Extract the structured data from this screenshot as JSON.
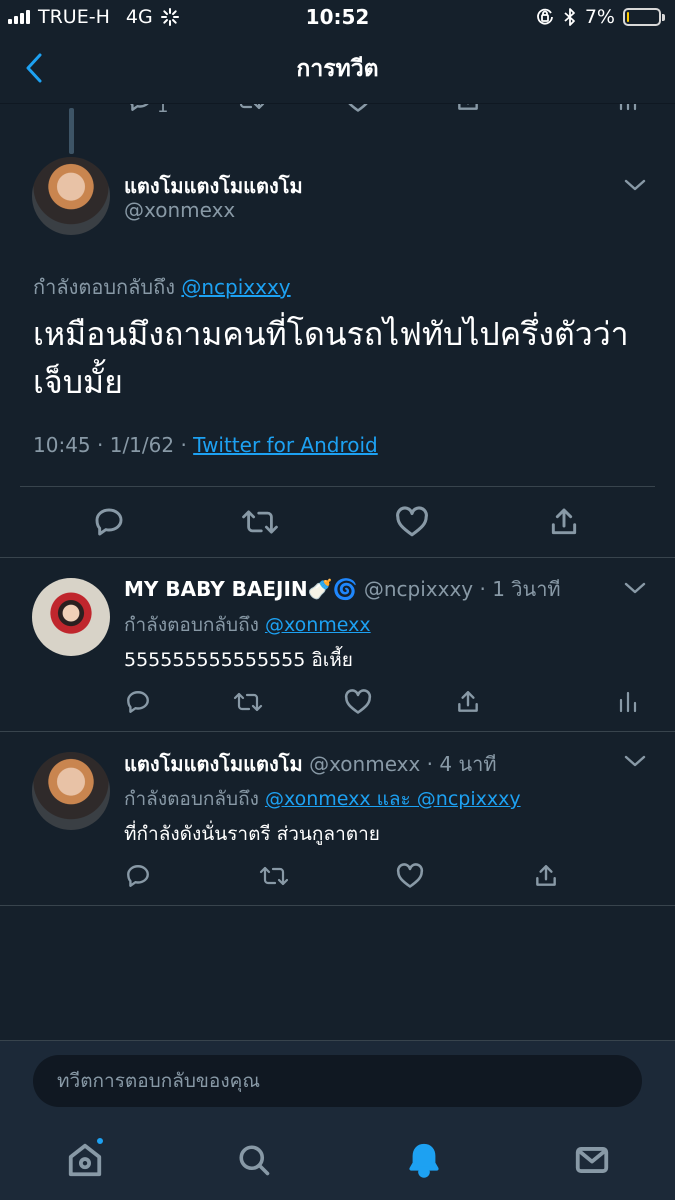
{
  "status_bar": {
    "carrier": "TRUE-H",
    "network": "4G",
    "time": "10:52",
    "battery_percent_label": "7%",
    "battery_level": 0.07
  },
  "nav": {
    "title": "การทวีต"
  },
  "top_actions": {
    "reply_count": "1"
  },
  "main_tweet": {
    "name": "แตงโมแตงโมแตงโม",
    "handle": "@xonmexx",
    "replying_prefix": "กำลังตอบกลับถึง",
    "replying_to": "@ncpixxxy",
    "body": "เหมือนมึงถามคนที่โดนรถไฟทับไปครึ่งตัวว่าเจ็บมั้ย",
    "time": "10:45",
    "date": "1/1/62",
    "source": "Twitter for Android"
  },
  "replies": [
    {
      "name": "MY BABY BAEJIN",
      "name_emoji": "🍼🌀",
      "handle": "@ncpixxxy",
      "time_ago": "1 วินาที",
      "replying_prefix": "กำลังตอบกลับถึง",
      "replying_to": "@xonmexx",
      "text": "555555555555555 อิเหี้ย"
    },
    {
      "name": "แตงโมแตงโมแตงโม",
      "handle": "@xonmexx",
      "time_ago": "4 นาที",
      "replying_prefix": "กำลังตอบกลับถึง",
      "replying_to": "@xonmexx และ @ncpixxxy",
      "text": "ที่กำลังดังนั่นราตรี ส่วนกูลาตาย"
    }
  ],
  "composer": {
    "placeholder": "ทวีตการตอบกลับของคุณ"
  },
  "colors": {
    "background": "#15202b",
    "accent": "#1da1f2",
    "muted": "#8899a6",
    "bar": "#1c2938"
  },
  "icons": [
    "back-icon",
    "reply-icon",
    "retweet-icon",
    "like-icon",
    "share-icon",
    "analytics-icon",
    "chevron-down-icon",
    "home-icon",
    "search-icon",
    "notifications-icon",
    "messages-icon"
  ]
}
